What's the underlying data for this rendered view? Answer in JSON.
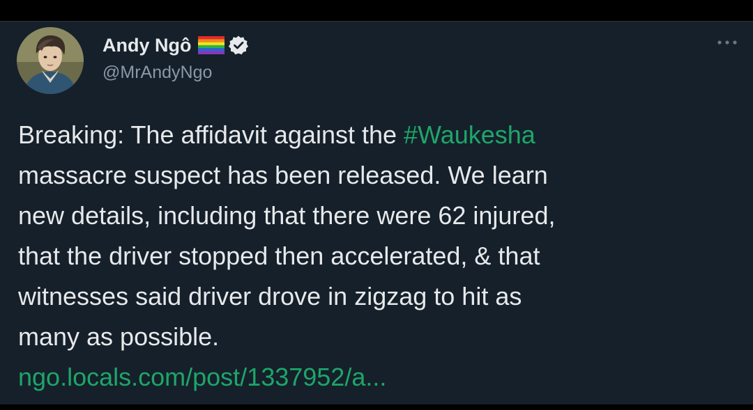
{
  "author": {
    "display_name": "Andy Ngô",
    "handle": "@MrAndyNgo",
    "flag_icon": "rainbow-flag-icon",
    "verified_icon": "verified-badge-icon"
  },
  "menu": {
    "icon": "more-options-icon"
  },
  "tweet": {
    "line1_before": "Breaking: The affidavit against the ",
    "hashtag": "#Waukesha",
    "line2": "massacre suspect has been released. We learn",
    "line3": "new details, including that there were 62 injured,",
    "line4": "that the driver stopped then accelerated, & that",
    "line5": "witnesses said driver drove in zigzag to hit as",
    "line6": "many as possible.",
    "link": "ngo.locals.com/post/1337952/a..."
  },
  "colors": {
    "background": "#15202b",
    "link": "#1ea668",
    "text": "#e7e9ea",
    "secondary": "#8b98a5"
  }
}
